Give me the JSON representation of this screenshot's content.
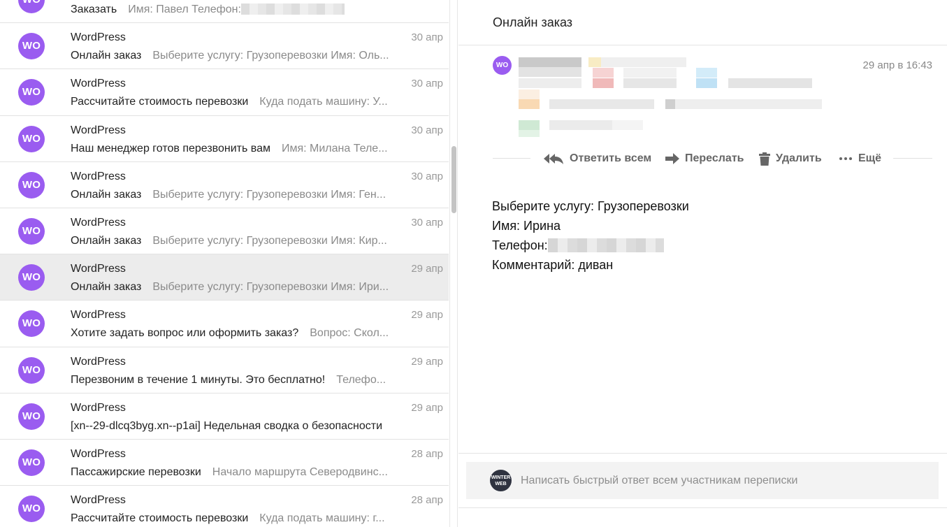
{
  "message_list": [
    {
      "sender": "",
      "date": "",
      "subject": "Заказать",
      "snippet": "Имя: Павел Телефон:",
      "blurred": true
    },
    {
      "sender": "WordPress",
      "date": "30 апр",
      "subject": "Онлайн заказ",
      "snippet": "Выберите услугу: Грузоперевозки Имя: Оль..."
    },
    {
      "sender": "WordPress",
      "date": "30 апр",
      "subject": "Рассчитайте стоимость перевозки",
      "snippet": "Куда подать машину: У..."
    },
    {
      "sender": "WordPress",
      "date": "30 апр",
      "subject": "Наш менеджер готов перезвонить вам",
      "snippet": "Имя: Милана Теле..."
    },
    {
      "sender": "WordPress",
      "date": "30 апр",
      "subject": "Онлайн заказ",
      "snippet": "Выберите услугу: Грузоперевозки Имя: Ген..."
    },
    {
      "sender": "WordPress",
      "date": "30 апр",
      "subject": "Онлайн заказ",
      "snippet": "Выберите услугу: Грузоперевозки Имя: Кир..."
    },
    {
      "sender": "WordPress",
      "date": "29 апр",
      "subject": "Онлайн заказ",
      "snippet": "Выберите услугу: Грузоперевозки Имя: Ири...",
      "active": true
    },
    {
      "sender": "WordPress",
      "date": "29 апр",
      "subject": "Хотите задать вопрос или оформить заказ?",
      "snippet": "Вопрос: Скол..."
    },
    {
      "sender": "WordPress",
      "date": "29 апр",
      "subject": "Перезвоним в течение 1 минуты. Это бесплатно!",
      "snippet": "Телефо..."
    },
    {
      "sender": "WordPress",
      "date": "29 апр",
      "subject": "[xn--29-dlcq3byg.xn--p1ai] Недельная сводка о безопасности",
      "snippet": ""
    },
    {
      "sender": "WordPress",
      "date": "28 апр",
      "subject": "Пассажирские перевозки",
      "snippet": "Начало маршрута Северодвинс..."
    },
    {
      "sender": "WordPress",
      "date": "28 апр",
      "subject": "Рассчитайте стоимость перевозки",
      "snippet": "Куда подать машину: г..."
    }
  ],
  "avatar_initials": "WO",
  "colors": {
    "avatar": "#9a5cf0",
    "active_row": "#ececec"
  },
  "pane": {
    "thread_title": "Онлайн заказ",
    "message_date": "29 апр в 16:43",
    "actions": {
      "reply_all": "Ответить всем",
      "forward": "Переслать",
      "delete": "Удалить",
      "more": "Ещё"
    },
    "body": {
      "line1": "Выберите услугу: Грузоперевозки",
      "line2": "Имя: Ирина",
      "line3_label": "Телефон:",
      "line4": "Комментарий: диван"
    },
    "quick_reply_placeholder": "Написать быстрый ответ всем участникам переписки",
    "quick_reply_avatar_text": "WINTER WEB"
  }
}
